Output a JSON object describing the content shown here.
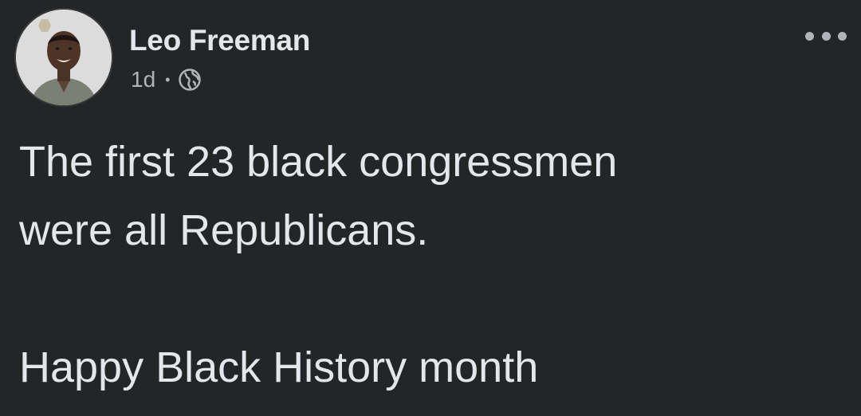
{
  "post": {
    "author": "Leo Freeman",
    "timestamp": "1d",
    "separator": "•",
    "audience_icon": "globe-icon",
    "more_icon": "more-options-icon",
    "lines": [
      "The first 23 black congressmen",
      "were all Republicans.",
      "Happy Black History month"
    ]
  },
  "colors": {
    "background": "#242526",
    "primary_text": "#e4e6eb",
    "secondary_text": "#b0b3b8"
  }
}
